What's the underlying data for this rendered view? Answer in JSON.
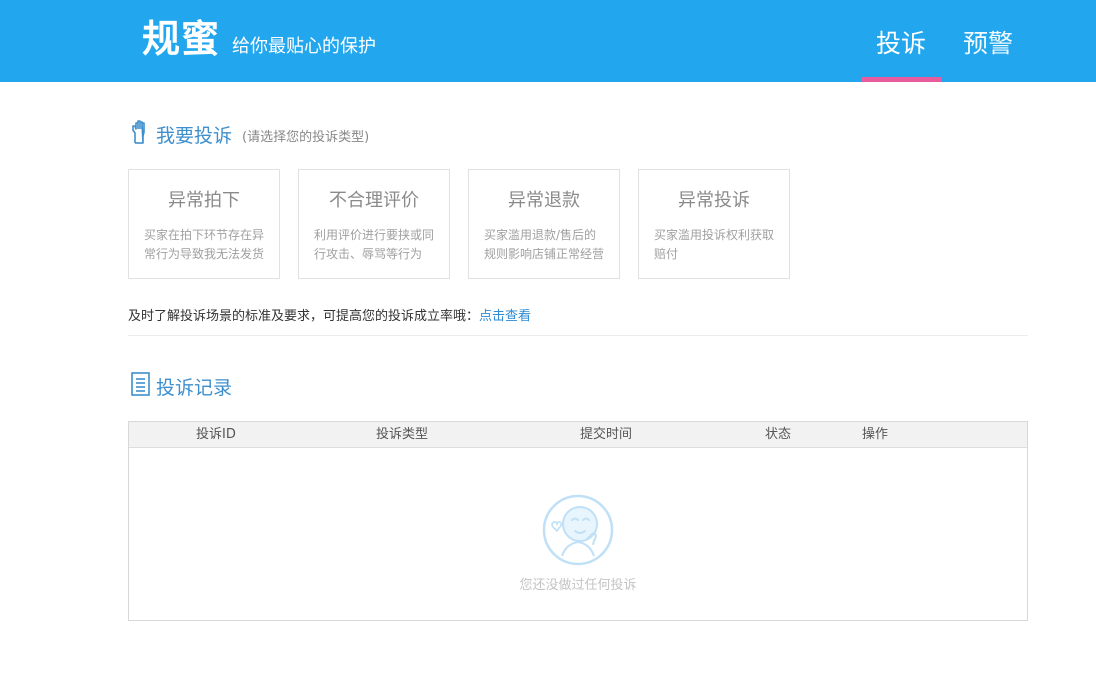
{
  "header": {
    "brand_name": "规蜜",
    "slogan": "给你最贴心的保护",
    "nav": [
      "投诉",
      "预警"
    ],
    "colors": {
      "bar": "#22a7ef",
      "active_underline": "#e85b9c"
    }
  },
  "complaint_section": {
    "title": "我要投诉",
    "hint": "(请选择您的投诉类型)",
    "icon": "hand-icon",
    "cards": [
      {
        "title": "异常拍下",
        "desc": "买家在拍下环节存在异常行为导致我无法发货"
      },
      {
        "title": "不合理评价",
        "desc": "利用评价进行要挟或同行攻击、辱骂等行为"
      },
      {
        "title": "异常退款",
        "desc": "买家滥用退款/售后的规则影响店铺正常经营"
      },
      {
        "title": "异常投诉",
        "desc": "买家滥用投诉权利获取赔付"
      }
    ],
    "tip_text": "及时了解投诉场景的标准及要求，可提高您的投诉成立率哦：",
    "tip_link": "点击查看"
  },
  "records_section": {
    "title": "投诉记录",
    "icon": "document-icon",
    "columns": [
      "投诉ID",
      "投诉类型",
      "提交时间",
      "状态",
      "操作"
    ],
    "rows": [],
    "empty_text": "您还没做过任何投诉",
    "empty_icon": "empty-face-icon"
  }
}
